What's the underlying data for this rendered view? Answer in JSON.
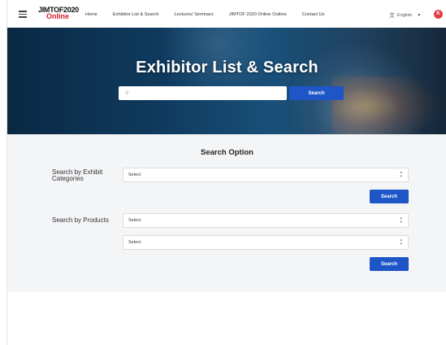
{
  "header": {
    "logo_line1": "JIMTOF2020",
    "logo_line2": "Online",
    "nav": [
      {
        "label": "Home"
      },
      {
        "label": "Exhibitor List & Search"
      },
      {
        "label": "Lectures/ Seminars"
      },
      {
        "label": "JIMTOF 2020 Online Outline"
      },
      {
        "label": "Contact Us"
      }
    ],
    "language": "English",
    "avatar_letter": "K"
  },
  "hero": {
    "title": "Exhibitor List & Search",
    "search_placeholder": "",
    "search_button": "Search"
  },
  "search_option": {
    "title": "Search Option",
    "categories": {
      "label": "Search by Exhibit Categories",
      "select_value": "Select",
      "button": "Search"
    },
    "products": {
      "label": "Search by Products",
      "select1_value": "Select",
      "select2_value": "Select",
      "button": "Search"
    }
  },
  "colors": {
    "accent": "#1e56c8",
    "logo_red": "#d71920",
    "avatar": "#e63c48",
    "panel_bg": "#f4f5f7"
  },
  "icons": [
    "menu-icon",
    "translate-icon",
    "chevron-down-icon",
    "search-icon",
    "select-arrows-icon"
  ]
}
